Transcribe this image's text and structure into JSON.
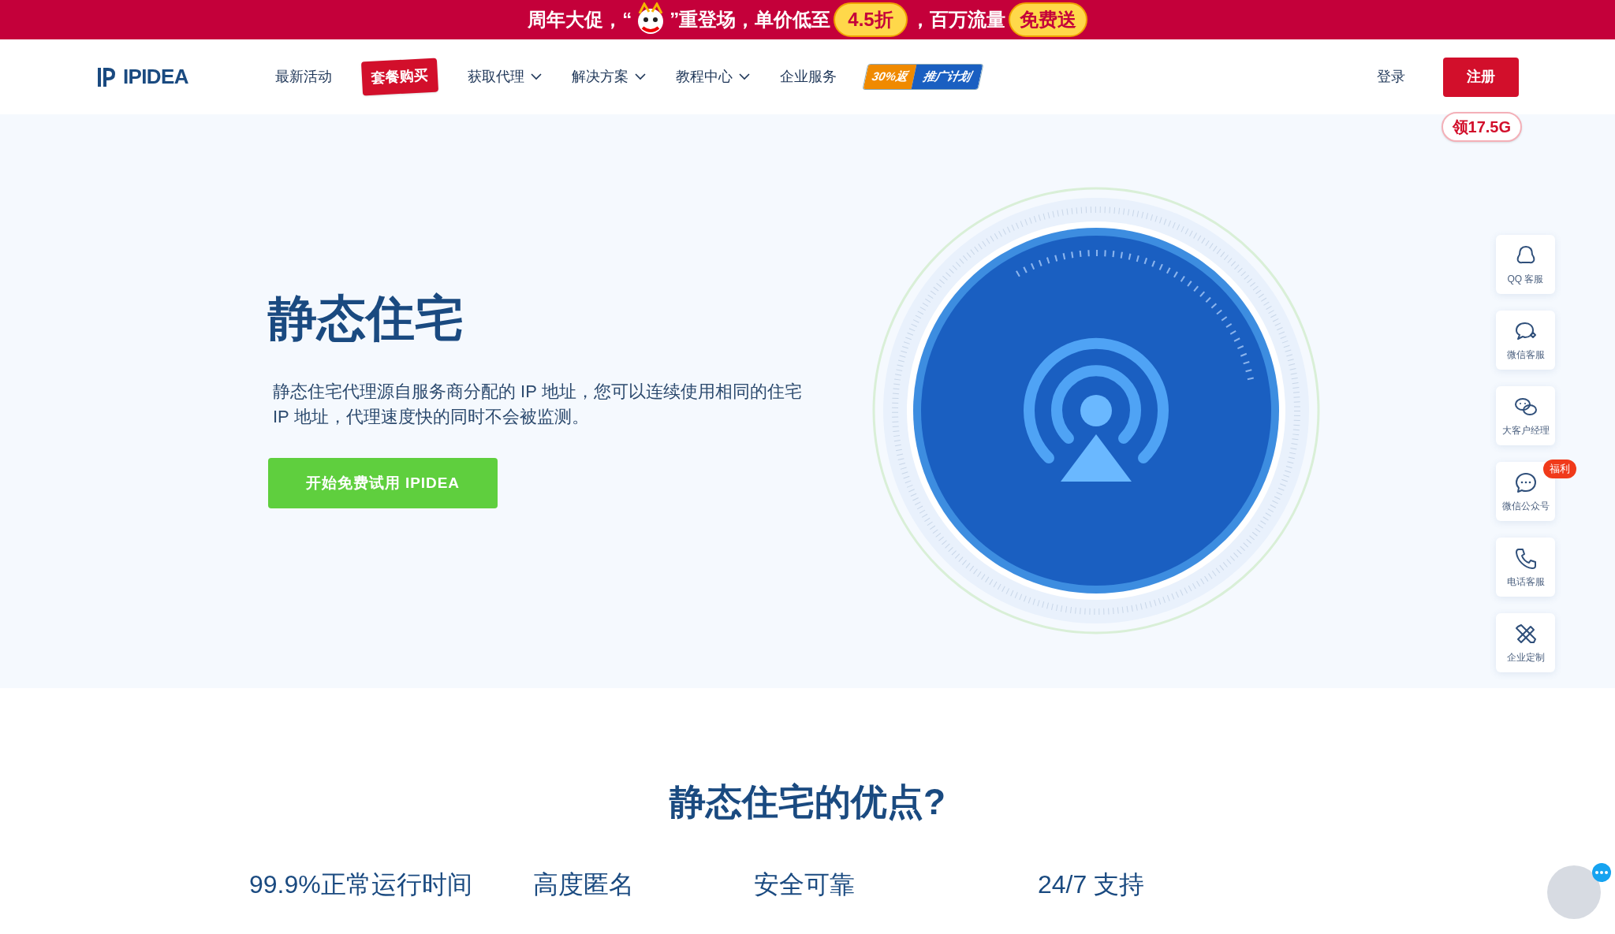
{
  "banner": {
    "text_before": "周年大促，“",
    "text_middle": "”重登场，单价低至",
    "discount": "4.5折",
    "text_after": "，百万流量",
    "free_badge": "免费送"
  },
  "nav": {
    "logo": "IPIDEA",
    "items": [
      {
        "kind": "link",
        "label": "最新活动"
      },
      {
        "kind": "badge",
        "label": "套餐购买"
      },
      {
        "kind": "dropdown",
        "label": "获取代理"
      },
      {
        "kind": "dropdown",
        "label": "解决方案"
      },
      {
        "kind": "dropdown",
        "label": "教程中心"
      },
      {
        "kind": "link",
        "label": "企业服务"
      },
      {
        "kind": "promo",
        "label": "30%返",
        "sublabel": "推广计划"
      }
    ],
    "login": "登录",
    "register": "注册",
    "gift_badge": "领17.5G"
  },
  "hero": {
    "title": "静态住宅",
    "description": "静态住宅代理源自服务商分配的 IP 地址，您可以连续使用相同的住宅 IP 地址，代理速度快的同时不会被监测。",
    "cta": "开始免费试用 IPIDEA"
  },
  "sidebar": [
    {
      "kind": "qq",
      "label": "QQ 客服"
    },
    {
      "kind": "chat",
      "label": "微信客服"
    },
    {
      "kind": "wechat",
      "label": "大客户经理"
    },
    {
      "kind": "dots",
      "label": "微信公众号",
      "badge": "福利"
    },
    {
      "kind": "phone",
      "label": "电话客服"
    },
    {
      "kind": "tools",
      "label": "企业定制"
    }
  ],
  "section_title": "静态住宅的优点?",
  "features": [
    "99.9%正常运行时间",
    "高度匿名",
    "安全可靠",
    "24/7 支持"
  ]
}
